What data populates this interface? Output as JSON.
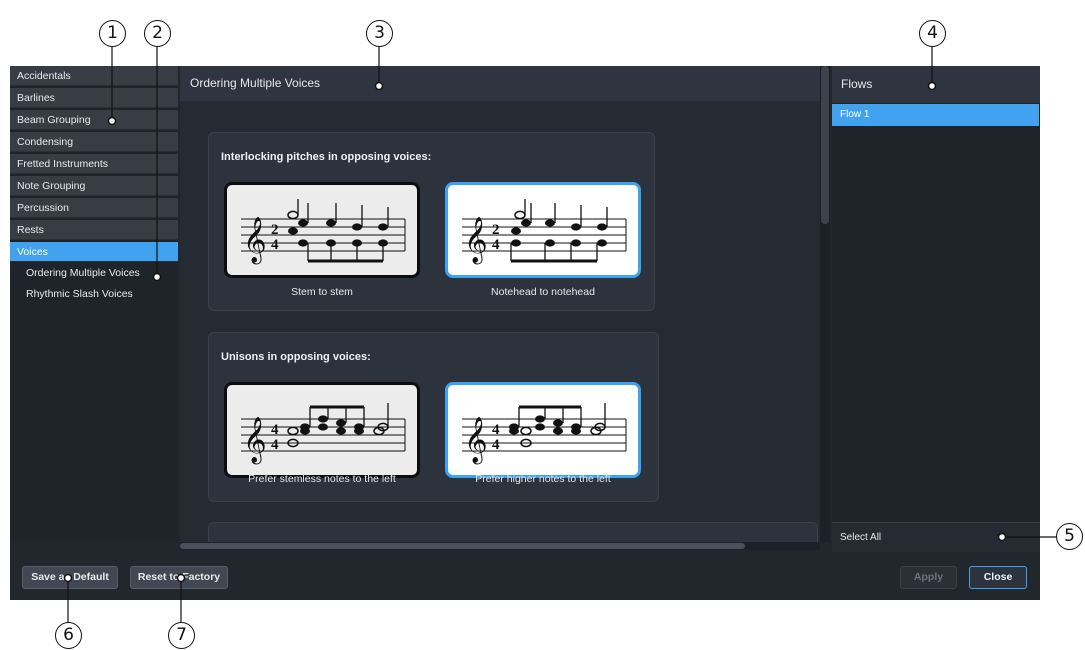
{
  "nav": {
    "items": [
      "Accidentals",
      "Barlines",
      "Beam Grouping",
      "Condensing",
      "Fretted Instruments",
      "Note Grouping",
      "Percussion",
      "Rests",
      "Voices"
    ],
    "selected": "Voices",
    "subitems": [
      "Ordering Multiple Voices",
      "Rhythmic Slash Voices"
    ]
  },
  "main": {
    "title": "Ordering Multiple Voices",
    "groups": [
      {
        "title": "Interlocking pitches in opposing voices:",
        "options": [
          {
            "label": "Stem to stem",
            "selected": false
          },
          {
            "label": "Notehead to notehead",
            "selected": true
          }
        ]
      },
      {
        "title": "Unisons in opposing voices:",
        "options": [
          {
            "label": "Prefer stemless notes to the left",
            "selected": false
          },
          {
            "label": "Prefer higher notes to the left",
            "selected": true
          }
        ]
      }
    ]
  },
  "flows": {
    "title": "Flows",
    "items": [
      "Flow 1"
    ],
    "select_all": "Select All"
  },
  "footer": {
    "save_default": "Save as Default",
    "reset_factory": "Reset to Factory",
    "apply": "Apply",
    "close": "Close"
  },
  "callouts": [
    "1",
    "2",
    "3",
    "4",
    "5",
    "6",
    "7"
  ],
  "icons": {
    "options": "music-notation-example-icon"
  },
  "colors": {
    "accent": "#41a3f0",
    "background": "#22272e"
  }
}
